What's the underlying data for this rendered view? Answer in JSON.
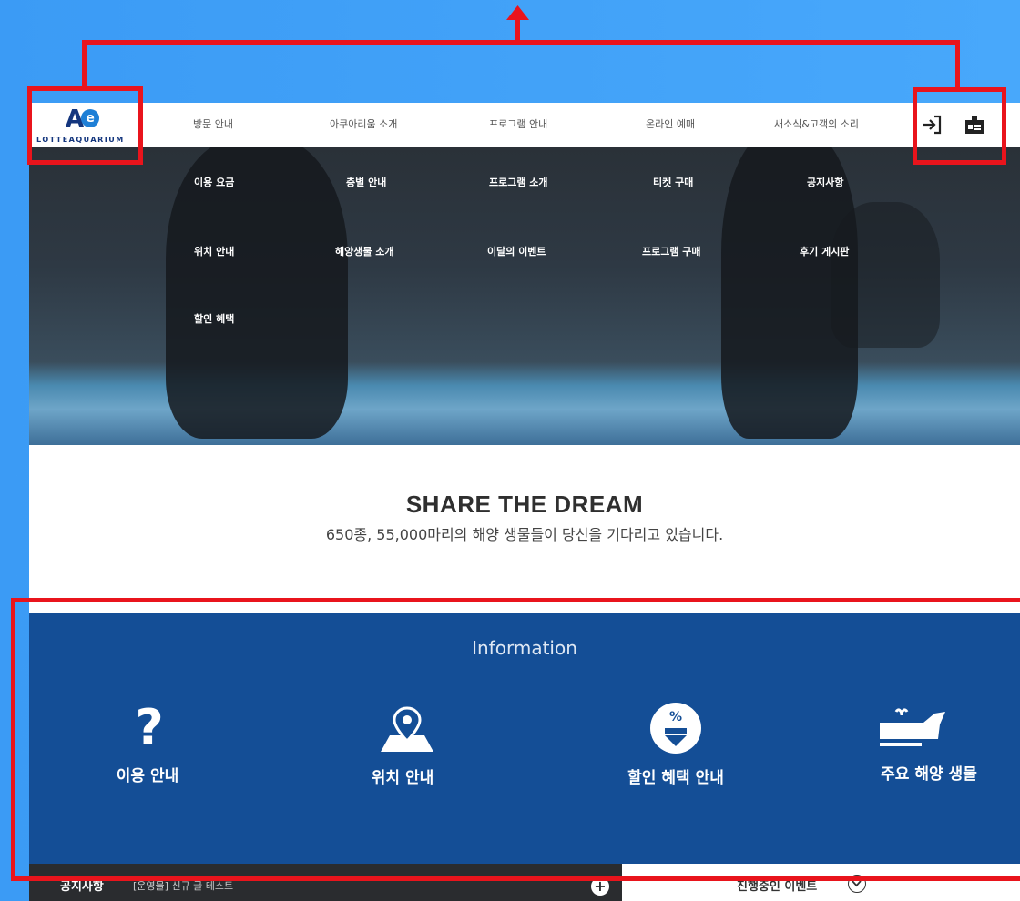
{
  "logo": {
    "mark": "AQ",
    "name": "LOTTEAQUARIUM"
  },
  "nav": {
    "menu": [
      "방문 안내",
      "아쿠아리움 소개",
      "프로그램 안내",
      "온라인 예매",
      "새소식&고객의 소리"
    ],
    "login_icon": "login-arrow-icon",
    "mypage_icon": "id-badge-icon"
  },
  "submenu": {
    "col1": [
      "이용 요금",
      "위치 안내",
      "할인 혜택"
    ],
    "col2": [
      "층별 안내",
      "해양생물 소개"
    ],
    "col3": [
      "프로그램 소개",
      "이달의 이벤트"
    ],
    "col4": [
      "티켓 구매",
      "프로그램 구매"
    ],
    "col5": [
      "공지사항",
      "후기 게시판"
    ]
  },
  "tagline": {
    "title": "SHARE THE DREAM",
    "subtitle": "650종, 55,000마리의 해양 생물들이 당신을 기다리고 있습니다."
  },
  "information": {
    "title": "Information",
    "items": [
      {
        "label": "이용 안내",
        "icon": "question-icon"
      },
      {
        "label": "위치 안내",
        "icon": "map-pin-icon"
      },
      {
        "label": "할인 혜택 안내",
        "icon": "discount-icon"
      },
      {
        "label": "주요 해양 생물",
        "icon": "whale-icon"
      }
    ]
  },
  "bottom": {
    "notice_label": "공지사항",
    "notice_text": "[운영물] 신규 글 테스트",
    "event_label": "진행중인 이벤트"
  },
  "colors": {
    "annotation": "#e9141c",
    "info_bg": "#144e96",
    "brand": "#14367e"
  }
}
